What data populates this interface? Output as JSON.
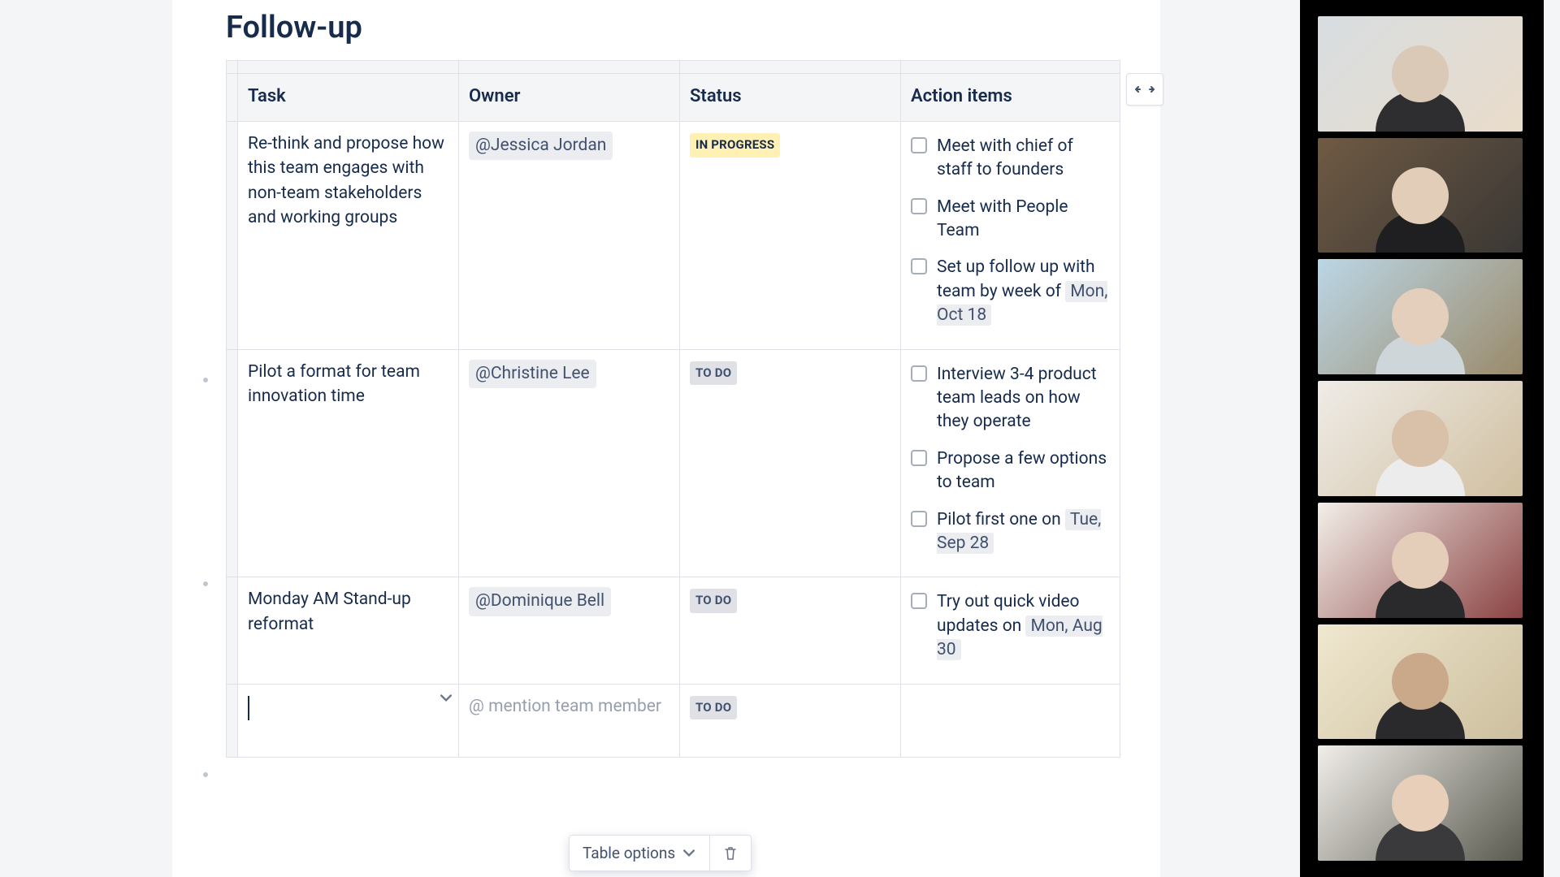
{
  "title": "Follow-up",
  "columns": {
    "task": "Task",
    "owner": "Owner",
    "status": "Status",
    "items": "Action items"
  },
  "status_labels": {
    "in_progress": "IN PROGRESS",
    "to_do": "TO DO"
  },
  "rows": [
    {
      "task": "Re-think and propose how this team engages with non-team stakeholders and working groups",
      "owner": "@Jessica Jordan",
      "status": "in_progress",
      "items": [
        {
          "text": "Meet with chief of staff to founders"
        },
        {
          "text": "Meet with People Team"
        },
        {
          "text_before": "Set up follow up with team by week of ",
          "date": "Mon, Oct 18"
        }
      ]
    },
    {
      "task": "Pilot a format for team innovation time",
      "owner": "@Christine Lee",
      "status": "to_do",
      "items": [
        {
          "text": "Interview 3-4 product team leads on how they operate"
        },
        {
          "text": "Propose a few options to team"
        },
        {
          "text_before": "Pilot first one on ",
          "date": "Tue, Sep 28"
        }
      ]
    },
    {
      "task": "Monday AM Stand-up reformat",
      "owner": "@Dominique Bell",
      "status": "to_do",
      "items": [
        {
          "text_before": "Try out quick video updates on ",
          "date": "Mon, Aug 30"
        }
      ]
    }
  ],
  "empty_row": {
    "owner_placeholder": "@ mention team member",
    "status": "to_do"
  },
  "toolbar": {
    "table_options": "Table options"
  },
  "video_tiles": [
    {
      "bg1": "#bfc7cf",
      "bg2": "#e6d7c2"
    },
    {
      "bg1": "#6f5a44",
      "bg2": "#3a3734"
    },
    {
      "bg1": "#bcd6e6",
      "bg2": "#8a7a5d"
    },
    {
      "bg1": "#e7e4df",
      "bg2": "#c9b79a"
    },
    {
      "bg1": "#efece8",
      "bg2": "#7a3b3b"
    },
    {
      "bg1": "#efe7cf",
      "bg2": "#cdbf9e"
    },
    {
      "bg1": "#efece8",
      "bg2": "#4b4b44"
    }
  ]
}
